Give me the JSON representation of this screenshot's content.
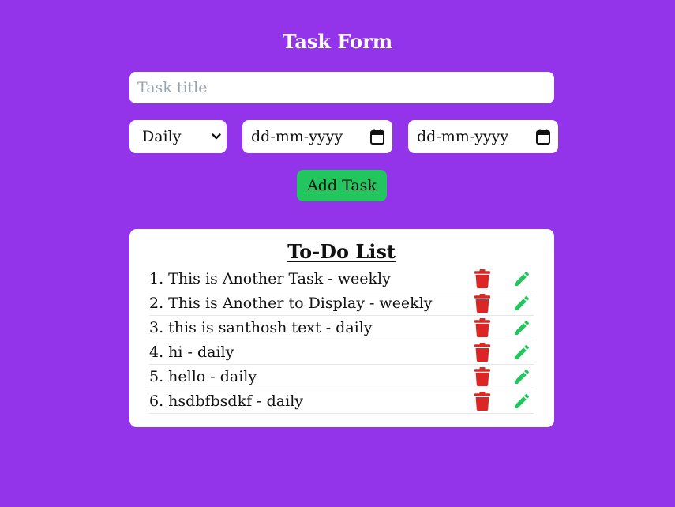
{
  "form": {
    "title": "Task Form",
    "title_placeholder": "Task title",
    "frequency_value": "Daily",
    "start_date_placeholder": "dd-mm-yyyy",
    "end_date_placeholder": "dd-mm-yyyy",
    "add_button_label": "Add Task"
  },
  "todo": {
    "heading": "To-Do List",
    "items": [
      {
        "number": "1.",
        "text": "This is Another Task - weekly"
      },
      {
        "number": "2.",
        "text": "This is Another to Display - weekly"
      },
      {
        "number": "3.",
        "text": "this is santhosh text - daily"
      },
      {
        "number": "4.",
        "text": "hi - daily"
      },
      {
        "number": "5.",
        "text": "hello - daily"
      },
      {
        "number": "6.",
        "text": "hsdbfbsdkf - daily"
      }
    ],
    "delete_icon": "trash-icon",
    "edit_icon": "pencil-icon"
  },
  "colors": {
    "background": "#9333ea",
    "add_button": "#22c55e",
    "delete_icon": "#dc2626",
    "edit_icon": "#22c55e",
    "card": "#ffffff"
  }
}
